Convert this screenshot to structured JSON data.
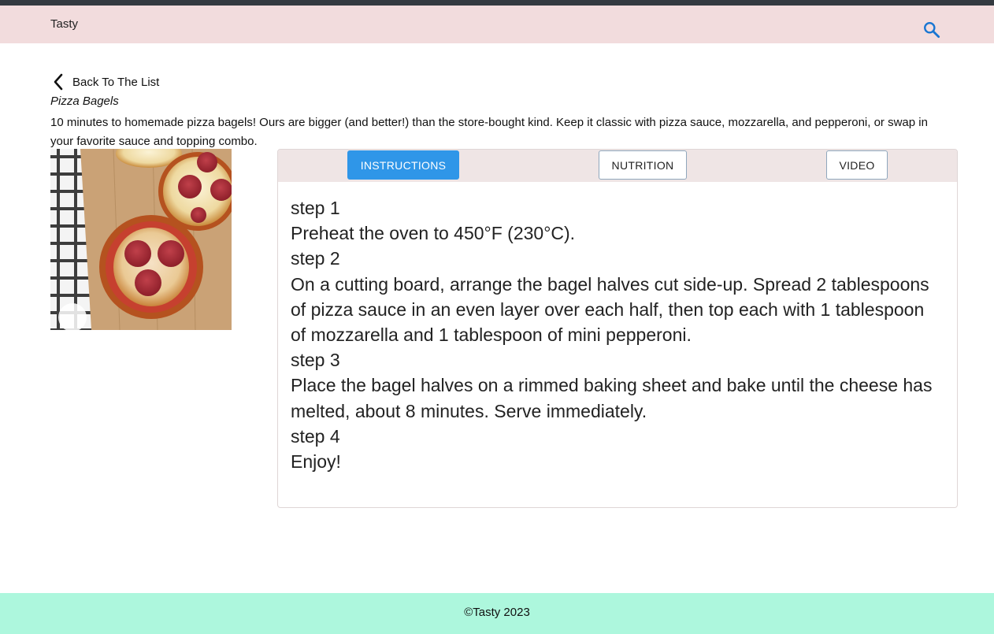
{
  "navbar": {
    "brand": "Tasty",
    "search_icon": "search-icon",
    "background": "#f2dcdd"
  },
  "back_link": {
    "label": "Back To The List",
    "icon": "chevron-left-icon"
  },
  "recipe": {
    "title": "Pizza Bagels",
    "description": "10 minutes to homemade pizza bagels! Ours are bigger (and better!) than the store-bought kind. Keep it classic with pizza sauce, mozzarella, and pepperoni, or swap in your favorite sauce and topping combo."
  },
  "tabs": [
    {
      "label": "INSTRUCTIONS",
      "active": true
    },
    {
      "label": "NUTRITION",
      "active": false
    },
    {
      "label": "VIDEO",
      "active": false
    }
  ],
  "steps": [
    {
      "label": "step 1",
      "text": "Preheat the oven to 450°F (230°C)."
    },
    {
      "label": "step 2",
      "text": "On a cutting board, arrange the bagel halves cut side-up. Spread 2 tablespoons of pizza sauce in an even layer over each half, then top each with 1 tablespoon of mozzarella and 1 tablespoon of mini pepperoni."
    },
    {
      "label": "step 3",
      "text": "Place the bagel halves on a rimmed baking sheet and bake until the cheese has melted, about 8 minutes. Serve immediately."
    },
    {
      "label": "step 4",
      "text": "Enjoy!"
    }
  ],
  "footer": {
    "text": "©Tasty 2023",
    "background": "#adf7dd"
  },
  "colors": {
    "accent": "#2f96e8",
    "search_icon": "#1976d2"
  }
}
